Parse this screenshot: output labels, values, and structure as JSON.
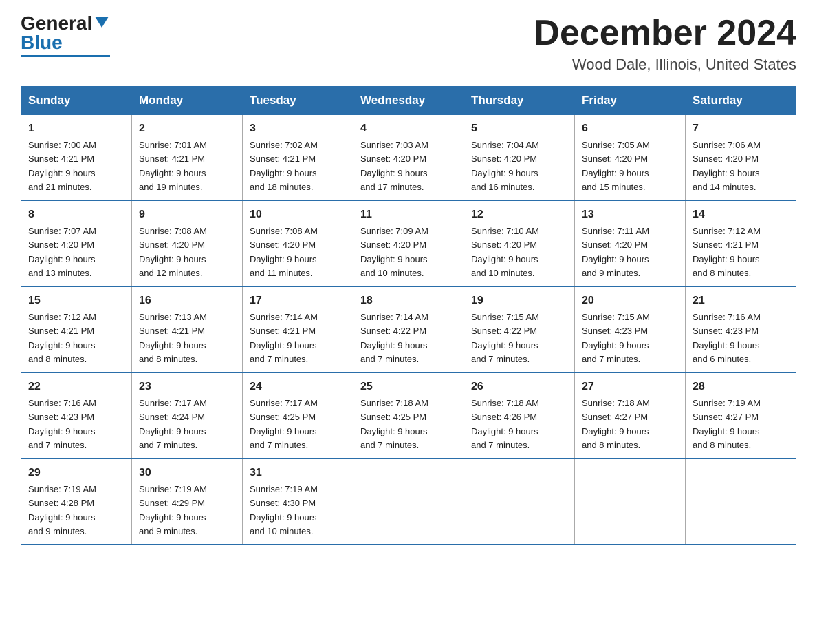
{
  "logo": {
    "general": "General",
    "blue": "Blue"
  },
  "title": "December 2024",
  "location": "Wood Dale, Illinois, United States",
  "days_of_week": [
    "Sunday",
    "Monday",
    "Tuesday",
    "Wednesday",
    "Thursday",
    "Friday",
    "Saturday"
  ],
  "weeks": [
    [
      {
        "num": "1",
        "sunrise": "7:00 AM",
        "sunset": "4:21 PM",
        "daylight": "9 hours and 21 minutes."
      },
      {
        "num": "2",
        "sunrise": "7:01 AM",
        "sunset": "4:21 PM",
        "daylight": "9 hours and 19 minutes."
      },
      {
        "num": "3",
        "sunrise": "7:02 AM",
        "sunset": "4:21 PM",
        "daylight": "9 hours and 18 minutes."
      },
      {
        "num": "4",
        "sunrise": "7:03 AM",
        "sunset": "4:20 PM",
        "daylight": "9 hours and 17 minutes."
      },
      {
        "num": "5",
        "sunrise": "7:04 AM",
        "sunset": "4:20 PM",
        "daylight": "9 hours and 16 minutes."
      },
      {
        "num": "6",
        "sunrise": "7:05 AM",
        "sunset": "4:20 PM",
        "daylight": "9 hours and 15 minutes."
      },
      {
        "num": "7",
        "sunrise": "7:06 AM",
        "sunset": "4:20 PM",
        "daylight": "9 hours and 14 minutes."
      }
    ],
    [
      {
        "num": "8",
        "sunrise": "7:07 AM",
        "sunset": "4:20 PM",
        "daylight": "9 hours and 13 minutes."
      },
      {
        "num": "9",
        "sunrise": "7:08 AM",
        "sunset": "4:20 PM",
        "daylight": "9 hours and 12 minutes."
      },
      {
        "num": "10",
        "sunrise": "7:08 AM",
        "sunset": "4:20 PM",
        "daylight": "9 hours and 11 minutes."
      },
      {
        "num": "11",
        "sunrise": "7:09 AM",
        "sunset": "4:20 PM",
        "daylight": "9 hours and 10 minutes."
      },
      {
        "num": "12",
        "sunrise": "7:10 AM",
        "sunset": "4:20 PM",
        "daylight": "9 hours and 10 minutes."
      },
      {
        "num": "13",
        "sunrise": "7:11 AM",
        "sunset": "4:20 PM",
        "daylight": "9 hours and 9 minutes."
      },
      {
        "num": "14",
        "sunrise": "7:12 AM",
        "sunset": "4:21 PM",
        "daylight": "9 hours and 8 minutes."
      }
    ],
    [
      {
        "num": "15",
        "sunrise": "7:12 AM",
        "sunset": "4:21 PM",
        "daylight": "9 hours and 8 minutes."
      },
      {
        "num": "16",
        "sunrise": "7:13 AM",
        "sunset": "4:21 PM",
        "daylight": "9 hours and 8 minutes."
      },
      {
        "num": "17",
        "sunrise": "7:14 AM",
        "sunset": "4:21 PM",
        "daylight": "9 hours and 7 minutes."
      },
      {
        "num": "18",
        "sunrise": "7:14 AM",
        "sunset": "4:22 PM",
        "daylight": "9 hours and 7 minutes."
      },
      {
        "num": "19",
        "sunrise": "7:15 AM",
        "sunset": "4:22 PM",
        "daylight": "9 hours and 7 minutes."
      },
      {
        "num": "20",
        "sunrise": "7:15 AM",
        "sunset": "4:23 PM",
        "daylight": "9 hours and 7 minutes."
      },
      {
        "num": "21",
        "sunrise": "7:16 AM",
        "sunset": "4:23 PM",
        "daylight": "9 hours and 6 minutes."
      }
    ],
    [
      {
        "num": "22",
        "sunrise": "7:16 AM",
        "sunset": "4:23 PM",
        "daylight": "9 hours and 7 minutes."
      },
      {
        "num": "23",
        "sunrise": "7:17 AM",
        "sunset": "4:24 PM",
        "daylight": "9 hours and 7 minutes."
      },
      {
        "num": "24",
        "sunrise": "7:17 AM",
        "sunset": "4:25 PM",
        "daylight": "9 hours and 7 minutes."
      },
      {
        "num": "25",
        "sunrise": "7:18 AM",
        "sunset": "4:25 PM",
        "daylight": "9 hours and 7 minutes."
      },
      {
        "num": "26",
        "sunrise": "7:18 AM",
        "sunset": "4:26 PM",
        "daylight": "9 hours and 7 minutes."
      },
      {
        "num": "27",
        "sunrise": "7:18 AM",
        "sunset": "4:27 PM",
        "daylight": "9 hours and 8 minutes."
      },
      {
        "num": "28",
        "sunrise": "7:19 AM",
        "sunset": "4:27 PM",
        "daylight": "9 hours and 8 minutes."
      }
    ],
    [
      {
        "num": "29",
        "sunrise": "7:19 AM",
        "sunset": "4:28 PM",
        "daylight": "9 hours and 9 minutes."
      },
      {
        "num": "30",
        "sunrise": "7:19 AM",
        "sunset": "4:29 PM",
        "daylight": "9 hours and 9 minutes."
      },
      {
        "num": "31",
        "sunrise": "7:19 AM",
        "sunset": "4:30 PM",
        "daylight": "9 hours and 10 minutes."
      },
      null,
      null,
      null,
      null
    ]
  ],
  "labels": {
    "sunrise": "Sunrise:",
    "sunset": "Sunset:",
    "daylight": "Daylight:"
  }
}
